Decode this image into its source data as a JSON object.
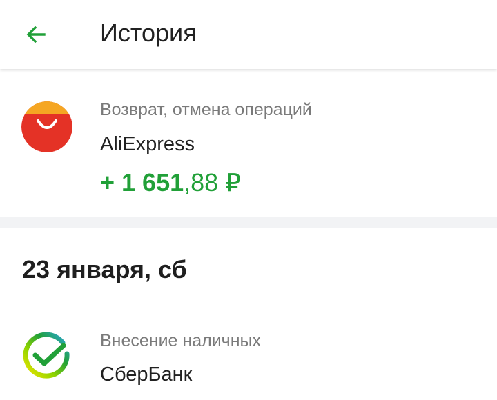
{
  "header": {
    "title": "История",
    "back_icon": "arrow-left-icon",
    "accent_color": "#21a038"
  },
  "transactions": [
    {
      "category": "Возврат, отмена операций",
      "merchant": "AliExpress",
      "amount_main": "+ 1 651",
      "amount_frac": ",88 ₽",
      "icon": "aliexpress-logo-icon",
      "amount_color": "#21a038"
    }
  ],
  "date_group": {
    "label": "23 января, сб",
    "transactions": [
      {
        "category": "Внесение наличных",
        "merchant": "СберБанк",
        "icon": "sberbank-logo-icon"
      }
    ]
  }
}
